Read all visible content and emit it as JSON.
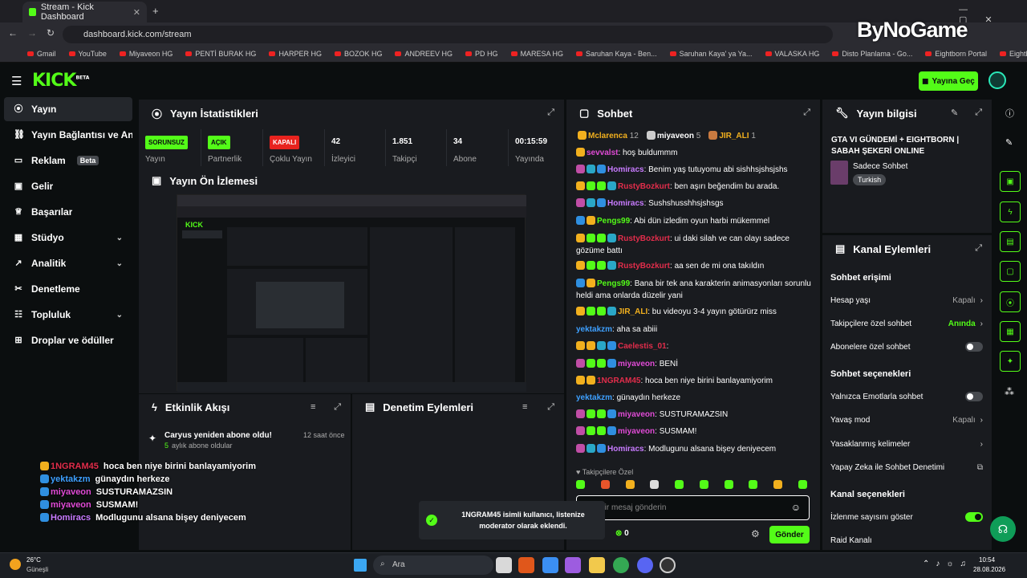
{
  "browser": {
    "tab_title": "Stream - Kick Dashboard",
    "url": "dashboard.kick.com/stream",
    "bookmarks": [
      "Gmail",
      "YouTube",
      "Miyaveon HG",
      "PENTİ BURAK HG",
      "HARPER HG",
      "BOZOK HG",
      "ANDREEV HG",
      "PD HG",
      "MARESA HG",
      "Saruhan Kaya - Ben...",
      "Saruhan Kaya' ya Ya...",
      "VALASKA HG",
      "Disto Planlama - Go...",
      "Eightborn Portal",
      "EightbornV Has Hak..."
    ]
  },
  "watermark": "ByNoGame",
  "header": {
    "logo": "KICK",
    "logo_sup": "BETA",
    "go_live": "Yayına Geç"
  },
  "sidebar": {
    "items": [
      {
        "label": "Yayın",
        "icon": "radio-icon",
        "active": true
      },
      {
        "label": "Yayın Bağlantısı ve Anahtar",
        "icon": "link-icon"
      },
      {
        "label": "Reklam",
        "icon": "ad-icon",
        "badge": "Beta"
      },
      {
        "label": "Gelir",
        "icon": "wallet-icon"
      },
      {
        "label": "Başarılar",
        "icon": "trophy-icon"
      },
      {
        "label": "Stüdyo",
        "icon": "studio-icon",
        "chevron": true
      },
      {
        "label": "Analitik",
        "icon": "chart-icon",
        "chevron": true
      },
      {
        "label": "Denetleme",
        "icon": "shield-icon"
      },
      {
        "label": "Topluluk",
        "icon": "users-icon",
        "chevron": true
      },
      {
        "label": "Droplar ve ödüller",
        "icon": "gift-icon"
      }
    ]
  },
  "stats": {
    "title": "Yayın İstatistikleri",
    "items": [
      {
        "value": "SORUNSUZ",
        "label": "Yayın",
        "pill": "green"
      },
      {
        "value": "AÇIK",
        "label": "Partnerlik",
        "pill": "green"
      },
      {
        "value": "KAPALI",
        "label": "Çoklu Yayın",
        "pill": "red"
      },
      {
        "value": "42",
        "label": "İzleyici"
      },
      {
        "value": "1.851",
        "label": "Takipçi"
      },
      {
        "value": "34",
        "label": "Abone"
      },
      {
        "value": "00:15:59",
        "label": "Yayında"
      }
    ]
  },
  "preview": {
    "title": "Yayın Ön İzlemesi"
  },
  "activity": {
    "title": "Etkinlik Akışı",
    "event_title": "Caryus yeniden abone oldu!",
    "event_time": "12 saat önce",
    "event_sub_count": "5",
    "event_sub_text": "aylık abone oldular"
  },
  "moderation": {
    "title": "Denetim Eylemleri"
  },
  "chat": {
    "title": "Sohbet",
    "top_gifters": [
      {
        "name": "Mclarenca",
        "count": "12"
      },
      {
        "name": "miyaveon",
        "count": "5"
      },
      {
        "name": "JIR_ALI",
        "count": "1"
      }
    ],
    "messages": [
      {
        "user": "sevvalst",
        "text": "hoş buldummm",
        "color": "#e04bd6"
      },
      {
        "user": "Homiracs",
        "text": "Benim yaş tutuyomu abi sishhsjshsjshs",
        "color": "#c87bff"
      },
      {
        "user": "RustyBozkurt",
        "text": "ben aşırı beğendim bu arada.",
        "color": "#e22d4b"
      },
      {
        "user": "Homiracs",
        "text": "Sushshusshhsjshsgs",
        "color": "#c87bff"
      },
      {
        "user": "Pengs99",
        "text": "Abi dün izledim oyun harbi mükemmel",
        "color": "#53fc18"
      },
      {
        "user": "RustyBozkurt",
        "text": "ui daki silah ve can olayı sadece gözüme battı",
        "color": "#e22d4b"
      },
      {
        "user": "RustyBozkurt",
        "text": "aa sen de mi ona takıldın",
        "color": "#e22d4b"
      },
      {
        "user": "Pengs99",
        "text": "Bana bir tek ana karakterin animasyonları sorunlu heldi ama onlarda düzelir yani",
        "color": "#53fc18"
      },
      {
        "user": "JIR_ALI",
        "text": "bu videoyu 3-4 yayın götürürz miss",
        "color": "#f2b01e"
      },
      {
        "user": "yektakzm",
        "text": "aha sa abiii",
        "color": "#3ea0ff"
      },
      {
        "user": "Caelestis_01",
        "text": "",
        "color": "#e22d4b"
      },
      {
        "user": "miyaveon",
        "text": "BENİ",
        "color": "#e04bd6"
      },
      {
        "user": "1NGRAM45",
        "text": "hoca ben niye birini banlayamiyorim",
        "color": "#e22d4b"
      },
      {
        "user": "yektakzm",
        "text": "günaydın herkeze",
        "color": "#3ea0ff"
      },
      {
        "user": "miyaveon",
        "text": "SUSTURAMAZSIN",
        "color": "#e04bd6"
      },
      {
        "user": "miyaveon",
        "text": "SUSMAM!",
        "color": "#e04bd6"
      },
      {
        "user": "Homiracs",
        "text": "Modlugunu alsana bişey deniyecem",
        "color": "#c87bff"
      }
    ],
    "followers_only": "Takipçilere Özel",
    "input_placeholder": "Bir mesaj gönderin",
    "points": "0",
    "send": "Gönder"
  },
  "stream_info": {
    "title": "Yayın bilgisi",
    "stream_title": "GTA VI GÜNDEMİ + EIGHTBORN | SABAH ŞEKERİ ONLINE",
    "category": "Sadece Sohbet",
    "tag": "Turkish"
  },
  "channel_actions": {
    "title": "Kanal Eylemleri",
    "chat_access": "Sohbet erişimi",
    "account_age": "Hesap yaşı",
    "account_age_value": "Kapalı",
    "followers_chat": "Takipçilere özel sohbet",
    "followers_chat_value": "Anında",
    "subs_chat": "Abonelere özel sohbet",
    "chat_options": "Sohbet seçenekleri",
    "emote_only": "Yalnızca Emotlarla sohbet",
    "slow_mode": "Yavaş mod",
    "slow_mode_value": "Kapalı",
    "banned_words": "Yasaklanmış kelimeler",
    "ai_moderation": "Yapay Zeka ile Sohbet Denetimi",
    "channel_options": "Kanal seçenekleri",
    "show_viewers": "İzlenme sayısını göster",
    "raid": "Raid Kanalı"
  },
  "toast": "1NGRAM45 isimli kullanıcı, listenize moderator olarak eklendi.",
  "overlay": [
    {
      "user": "1NGRAM45",
      "text": "hoca ben niye birini banlayamiyorim",
      "color": "#e22d4b"
    },
    {
      "user": "yektakzm",
      "text": "günaydın herkeze",
      "color": "#3ea0ff"
    },
    {
      "user": "miyaveon",
      "text": "SUSTURAMAZSIN",
      "color": "#e04bd6"
    },
    {
      "user": "miyaveon",
      "text": "SUSMAM!",
      "color": "#e04bd6"
    },
    {
      "user": "Homiracs",
      "text": "Modlugunu alsana bişey deniyecem",
      "color": "#c87bff"
    }
  ],
  "taskbar": {
    "weather_temp": "26°C",
    "weather_desc": "Güneşli",
    "search": "Ara",
    "time": "10:54",
    "date": "28.08.2026"
  },
  "colors": {
    "accent": "#53fc18",
    "panel": "#191b1f",
    "bg": "#0b0e0f"
  }
}
